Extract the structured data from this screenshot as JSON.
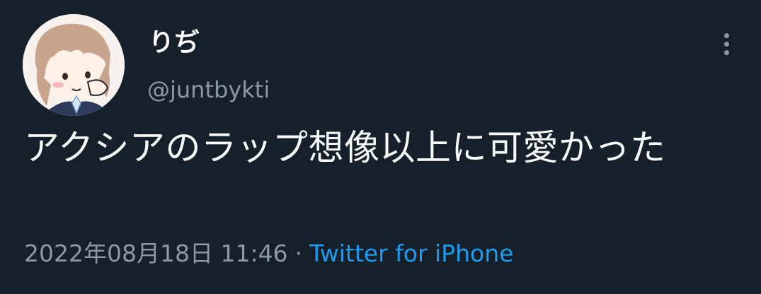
{
  "user": {
    "display_name": "りぢ",
    "handle": "@juntbykti",
    "avatar_icon": "cartoon-avatar"
  },
  "tweet": {
    "text": "アクシアのラップ想像以上に可愛かった",
    "timestamp": "2022年08月18日 11:46",
    "separator": "·",
    "source": "Twitter for iPhone"
  },
  "colors": {
    "background": "#15202b",
    "primary_text": "#ffffff",
    "secondary_text": "#8b98a5",
    "link": "#1d9bf0"
  },
  "icons": {
    "more": "more-vertical-icon"
  }
}
